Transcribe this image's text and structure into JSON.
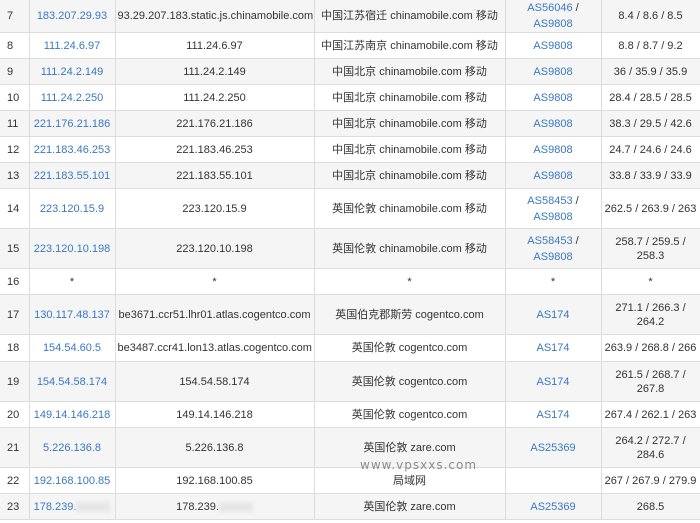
{
  "rows": [
    {
      "hop": "7",
      "ip": "183.207.29.93",
      "host": "93.29.207.183.static.js.chinamobile.com",
      "geo": "中国江苏宿迁 chinamobile.com 移动",
      "asn": [
        "AS56046",
        "AS9808"
      ],
      "latency": "8.4 / 8.6 / 8.5"
    },
    {
      "hop": "8",
      "ip": "111.24.6.97",
      "host": "111.24.6.97",
      "geo": "中国江苏南京 chinamobile.com 移动",
      "asn": [
        "AS9808"
      ],
      "latency": "8.8 / 8.7 / 9.2"
    },
    {
      "hop": "9",
      "ip": "111.24.2.149",
      "host": "111.24.2.149",
      "geo": "中国北京 chinamobile.com 移动",
      "asn": [
        "AS9808"
      ],
      "latency": "36 / 35.9 / 35.9"
    },
    {
      "hop": "10",
      "ip": "111.24.2.250",
      "host": "111.24.2.250",
      "geo": "中国北京 chinamobile.com 移动",
      "asn": [
        "AS9808"
      ],
      "latency": "28.4 / 28.5 / 28.5"
    },
    {
      "hop": "11",
      "ip": "221.176.21.186",
      "host": "221.176.21.186",
      "geo": "中国北京 chinamobile.com 移动",
      "asn": [
        "AS9808"
      ],
      "latency": "38.3 / 29.5 / 42.6"
    },
    {
      "hop": "12",
      "ip": "221.183.46.253",
      "host": "221.183.46.253",
      "geo": "中国北京 chinamobile.com 移动",
      "asn": [
        "AS9808"
      ],
      "latency": "24.7 / 24.6 / 24.6"
    },
    {
      "hop": "13",
      "ip": "221.183.55.101",
      "host": "221.183.55.101",
      "geo": "中国北京 chinamobile.com 移动",
      "asn": [
        "AS9808"
      ],
      "latency": "33.8 / 33.9 / 33.9"
    },
    {
      "hop": "14",
      "ip": "223.120.15.9",
      "host": "223.120.15.9",
      "geo": "英国伦敦 chinamobile.com 移动",
      "asn": [
        "AS58453",
        "AS9808"
      ],
      "latency": "262.5 / 263.9 / 263"
    },
    {
      "hop": "15",
      "ip": "223.120.10.198",
      "host": "223.120.10.198",
      "geo": "英国伦敦 chinamobile.com 移动",
      "asn": [
        "AS58453",
        "AS9808"
      ],
      "latency": "258.7 / 259.5 / 258.3"
    },
    {
      "hop": "16",
      "ip": "*",
      "host": "*",
      "geo": "*",
      "asn": [],
      "asn_text": "*",
      "latency": "*"
    },
    {
      "hop": "17",
      "ip": "130.117.48.137",
      "host": "be3671.ccr51.lhr01.atlas.cogentco.com",
      "geo": "英国伯克郡斯劳 cogentco.com",
      "asn": [
        "AS174"
      ],
      "latency": "271.1 / 266.3 / 264.2"
    },
    {
      "hop": "18",
      "ip": "154.54.60.5",
      "host": "be3487.ccr41.lon13.atlas.cogentco.com",
      "geo": "英国伦敦 cogentco.com",
      "asn": [
        "AS174"
      ],
      "latency": "263.9 / 268.8 / 266"
    },
    {
      "hop": "19",
      "ip": "154.54.58.174",
      "host": "154.54.58.174",
      "geo": "英国伦敦 cogentco.com",
      "asn": [
        "AS174"
      ],
      "latency": "261.5 / 268.7 / 267.8"
    },
    {
      "hop": "20",
      "ip": "149.14.146.218",
      "host": "149.14.146.218",
      "geo": "英国伦敦 cogentco.com",
      "asn": [
        "AS174"
      ],
      "latency": "267.4 / 262.1 / 263"
    },
    {
      "hop": "21",
      "ip": "5.226.136.8",
      "host": "5.226.136.8",
      "geo": "英国伦敦 zare.com",
      "asn": [
        "AS25369"
      ],
      "latency": "264.2 / 272.7 / 284.6"
    },
    {
      "hop": "22",
      "ip": "192.168.100.85",
      "host": "192.168.100.85",
      "geo": "局域网",
      "asn": [],
      "asn_text": "",
      "latency": "267 / 267.9 / 279.9"
    },
    {
      "hop": "23",
      "ip": "178.239.",
      "host": "178.239.",
      "geo": "英国伦敦 zare.com",
      "asn": [
        "AS25369"
      ],
      "latency": "268.5"
    }
  ],
  "watermark": "www.vpsxxs.com",
  "colors": {
    "link": "#3a78c3",
    "row_alt": "#f5f5f5",
    "border": "#dcdcdc"
  }
}
